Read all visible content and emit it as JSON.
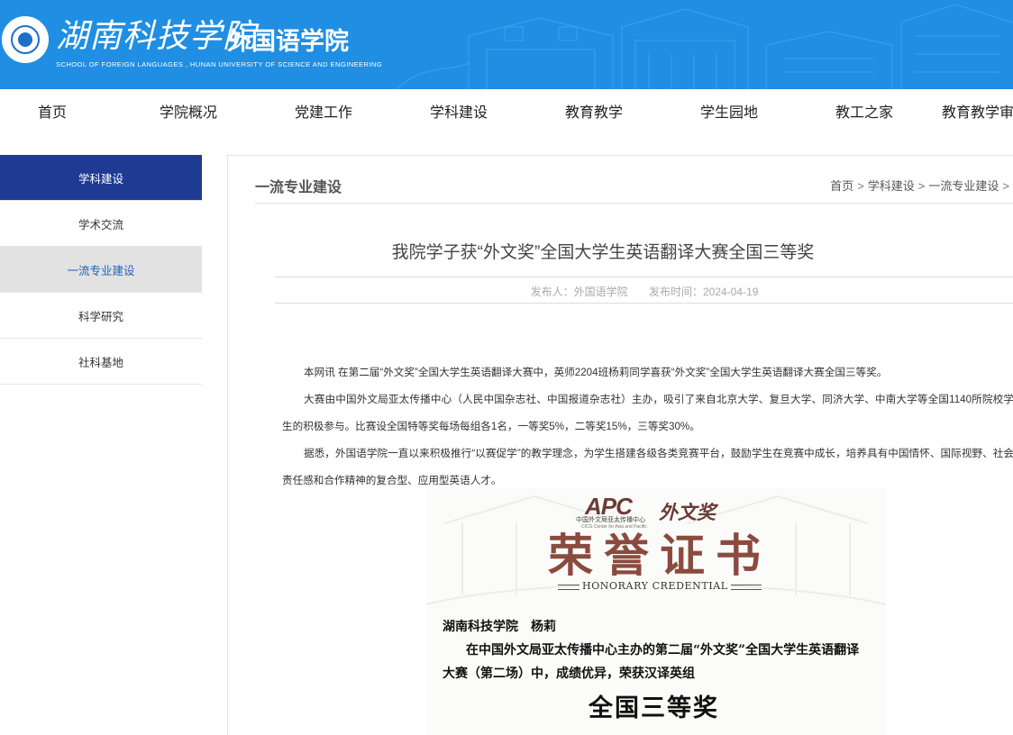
{
  "header": {
    "university_name": "湖南科技学院",
    "school_name": "外国语学院",
    "school_name_en": "SCHOOL OF FOREIGN LANGUAGES , HUNAN UNIVERSITY OF SCIENCE AND ENGINEERING",
    "background_color": "#1f8ee3"
  },
  "nav": {
    "items": [
      "首页",
      "学院概况",
      "党建工作",
      "学科建设",
      "教育教学",
      "学生园地",
      "教工之家",
      "教育教学审"
    ]
  },
  "sidebar": {
    "heading": "学科建设",
    "items": [
      "学术交流",
      "一流专业建设",
      "科学研究",
      "社科基地"
    ],
    "active_item": "一流专业建设",
    "heading_color": "#1e3a93",
    "active_text_color": "#1a63b8"
  },
  "content": {
    "section_title": "一流专业建设",
    "breadcrumb": [
      "首页",
      "学科建设",
      "一流专业建设"
    ],
    "breadcrumb_separator": ">",
    "article": {
      "title": "我院学子获“外文奖”全国大学生英语翻译大赛全国三等奖",
      "publisher": "发布人：外国语学院",
      "publish_time": "发布时间：2024-04-19",
      "paragraphs": [
        "本网讯 在第二届“外文奖”全国大学生英语翻译大赛中，英师2204班杨莉同学喜获“外文奖”全国大学生英语翻译大赛全国三等奖。",
        "大赛由中国外文局亚太传播中心（人民中国杂志社、中国报道杂志社）主办，吸引了来自北京大学、复旦大学、同济大学、中南大学等全国1140所院校学生的积极参与。比赛设全国特等奖每场每组各1名，一等奖5%，二等奖15%，三等奖30%。",
        "据悉，外国语学院一直以来积极推行“以赛促学”的教学理念，为学生搭建各级各类竞赛平台，鼓励学生在竞赛中成长，培养具有中国情怀、国际视野、社会责任感和合作精神的复合型、应用型英语人才。"
      ]
    }
  },
  "certificate": {
    "logo_text": "APC",
    "logo_sub": "中国外文局亚太传播中心",
    "logo_sub_en": "CICG Center for Asia and Pacific",
    "award_logo": "外文奖",
    "title": "荣誉证书",
    "title_en": "HONORARY CREDENTIAL",
    "recipient": "湖南科技学院　杨莉",
    "line2": "在中国外文局亚太传播中心主办的第二届“外文奖”全国大学生英语翻译",
    "line3": "大赛（第二场）中，成绩优异，荣获汉译英组",
    "award": "全国三等奖",
    "title_color": "#8a4b3e"
  }
}
